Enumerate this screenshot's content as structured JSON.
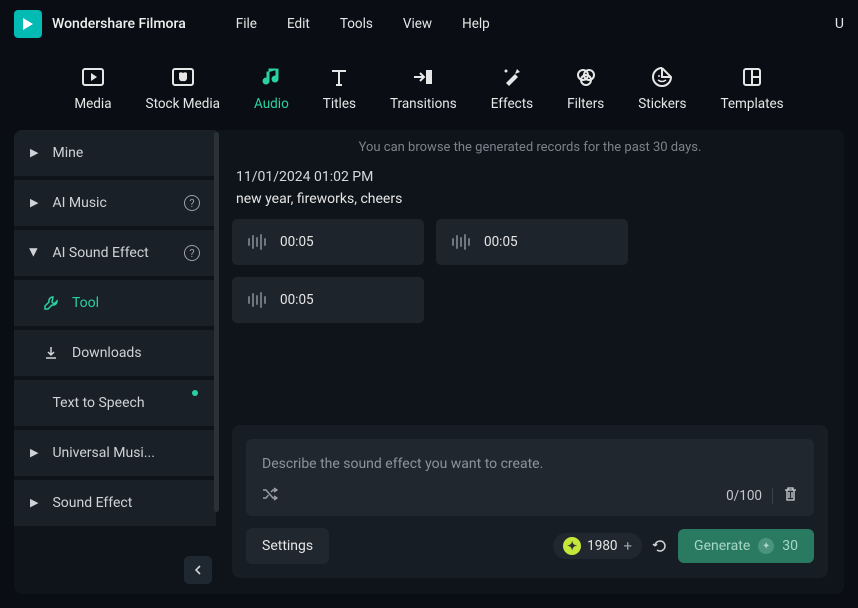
{
  "app": {
    "title": "Wondershare Filmora"
  },
  "menubar": [
    "File",
    "Edit",
    "Tools",
    "View",
    "Help"
  ],
  "rightChar": "U",
  "toolbar": [
    {
      "id": "media",
      "label": "Media"
    },
    {
      "id": "stock-media",
      "label": "Stock Media"
    },
    {
      "id": "audio",
      "label": "Audio",
      "active": true
    },
    {
      "id": "titles",
      "label": "Titles"
    },
    {
      "id": "transitions",
      "label": "Transitions"
    },
    {
      "id": "effects",
      "label": "Effects"
    },
    {
      "id": "filters",
      "label": "Filters"
    },
    {
      "id": "stickers",
      "label": "Stickers"
    },
    {
      "id": "templates",
      "label": "Templates"
    }
  ],
  "sidebar": {
    "items": [
      {
        "id": "mine",
        "label": "Mine",
        "hasChildren": true
      },
      {
        "id": "ai-music",
        "label": "AI Music",
        "hasChildren": true,
        "info": true
      },
      {
        "id": "ai-sound-effect",
        "label": "AI Sound Effect",
        "hasChildren": true,
        "info": true,
        "expanded": true,
        "children": [
          {
            "id": "tool",
            "label": "Tool",
            "active": true
          },
          {
            "id": "downloads",
            "label": "Downloads"
          }
        ]
      },
      {
        "id": "text-to-speech",
        "label": "Text to Speech",
        "dot": true
      },
      {
        "id": "universal-music",
        "label": "Universal Musi...",
        "hasChildren": true
      },
      {
        "id": "sound-effect",
        "label": "Sound Effect",
        "hasChildren": true
      }
    ]
  },
  "pane": {
    "hint": "You can browse the generated records for the past 30 days.",
    "record": {
      "timestamp": "11/01/2024 01:02 PM",
      "description": "new year, fireworks, cheers",
      "clips": [
        {
          "duration": "00:05"
        },
        {
          "duration": "00:05"
        },
        {
          "duration": "00:05"
        }
      ]
    },
    "prompt": {
      "placeholder": "Describe the sound effect you want to create.",
      "value": "",
      "counter": "0/100"
    },
    "settingsLabel": "Settings",
    "credits": "1980",
    "generate": {
      "label": "Generate",
      "cost": "30"
    }
  }
}
